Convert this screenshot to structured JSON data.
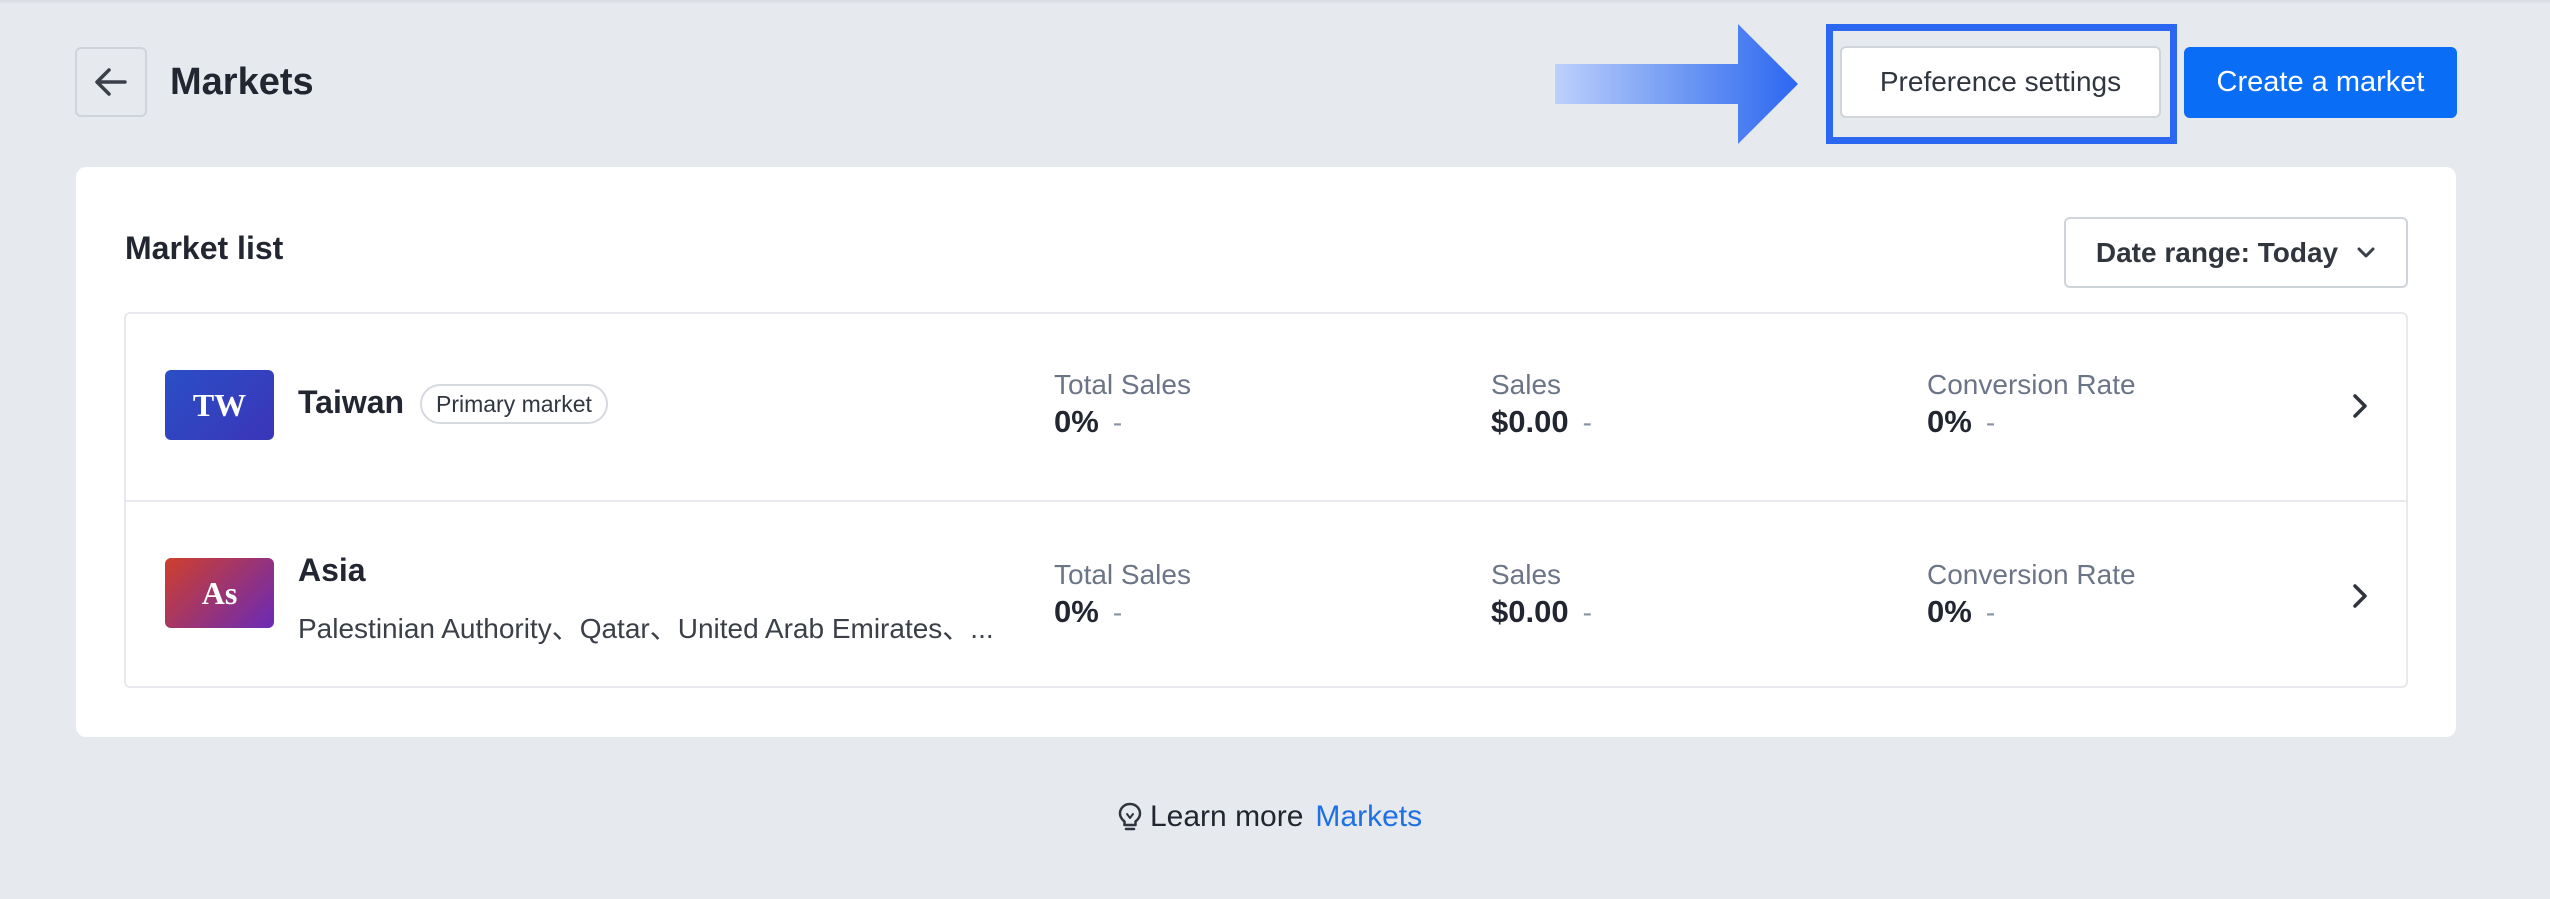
{
  "header": {
    "title": "Markets",
    "preference_label": "Preference settings",
    "create_label": "Create a market"
  },
  "card": {
    "title": "Market list",
    "date_range_label": "Date range: Today"
  },
  "metric_labels": {
    "total_sales": "Total Sales",
    "sales": "Sales",
    "conversion_rate": "Conversion Rate"
  },
  "markets": [
    {
      "avatar": "TW",
      "name": "Taiwan",
      "badge": "Primary market",
      "total_sales": "0%",
      "total_sales_change": "-",
      "sales": "$0.00",
      "sales_change": "-",
      "conversion_rate": "0%",
      "conversion_rate_change": "-"
    },
    {
      "avatar": "As",
      "name": "Asia",
      "regions": "Palestinian Authority、Qatar、United Arab Emirates、...",
      "total_sales": "0%",
      "total_sales_change": "-",
      "sales": "$0.00",
      "sales_change": "-",
      "conversion_rate": "0%",
      "conversion_rate_change": "-"
    }
  ],
  "footer": {
    "learn_more": "Learn more",
    "link": "Markets"
  },
  "icons": {
    "back": "arrow-left-icon",
    "dropdown": "chevron-down-icon",
    "row_action": "chevron-right-icon",
    "learn": "lightbulb-icon",
    "annotation": "pointer-arrow-icon"
  },
  "colors": {
    "background": "#e6e9ee",
    "primary": "#0a6df5",
    "highlight": "#2c67f2",
    "link": "#1f6fe5"
  }
}
